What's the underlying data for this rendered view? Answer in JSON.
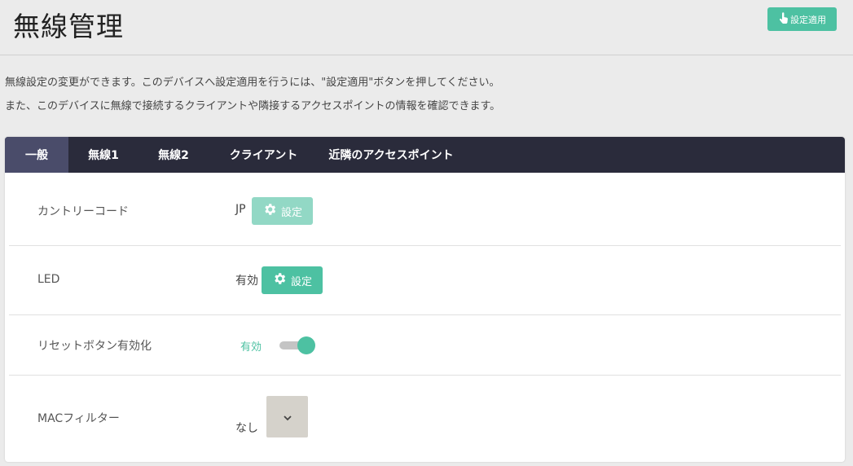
{
  "header": {
    "title": "無線管理",
    "apply_button": {
      "label": "設定適用",
      "icon": "hand-pointer-icon"
    }
  },
  "description": {
    "line1": "無線設定の変更ができます。このデバイスへ設定適用を行うには、\"設定適用\"ボタンを押してください。",
    "line2": "また、このデバイスに無線で接続するクライアントや隣接するアクセスポイントの情報を確認できます。"
  },
  "tabs": [
    {
      "label": "一般",
      "active": true
    },
    {
      "label": "無線1",
      "active": false
    },
    {
      "label": "無線2",
      "active": false
    },
    {
      "label": "クライアント",
      "active": false
    },
    {
      "label": "近隣のアクセスポイント",
      "active": false
    }
  ],
  "rows": {
    "country_code": {
      "label": "カントリーコード",
      "value": "JP",
      "button_label": "設定",
      "button_enabled": false
    },
    "led": {
      "label": "LED",
      "value": "有効",
      "button_label": "設定",
      "button_enabled": true
    },
    "reset_button": {
      "label": "リセットボタン有効化",
      "status": "有効",
      "enabled": true
    },
    "mac_filter": {
      "label": "MACフィルター",
      "value": "なし"
    }
  },
  "colors": {
    "accent": "#4dc1a2",
    "accent_disabled": "#92d8c5",
    "tab_bar": "#2a2b3b",
    "tab_active": "#4a4c6a",
    "page_bg": "#ebebeb"
  }
}
